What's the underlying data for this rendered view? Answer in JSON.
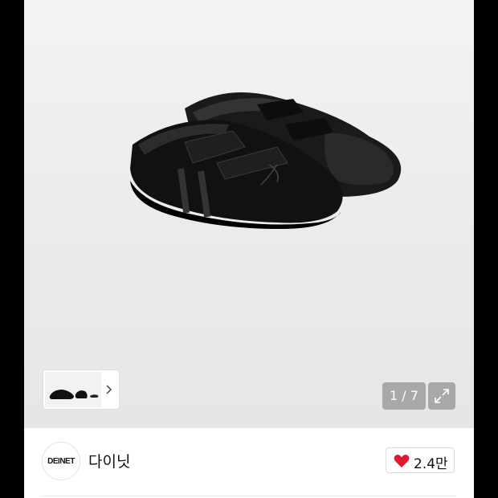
{
  "gallery": {
    "main_image": "black-mesh-velcro-sneakers",
    "thumbnail": "product-thumbnails",
    "counter": "1 / 7",
    "expand_icon": "expand-icon"
  },
  "brand": {
    "logo_text": "DEINET",
    "name": "다이닛"
  },
  "like": {
    "icon": "heart-icon",
    "count": "2.4만",
    "color": "#e0192e"
  }
}
